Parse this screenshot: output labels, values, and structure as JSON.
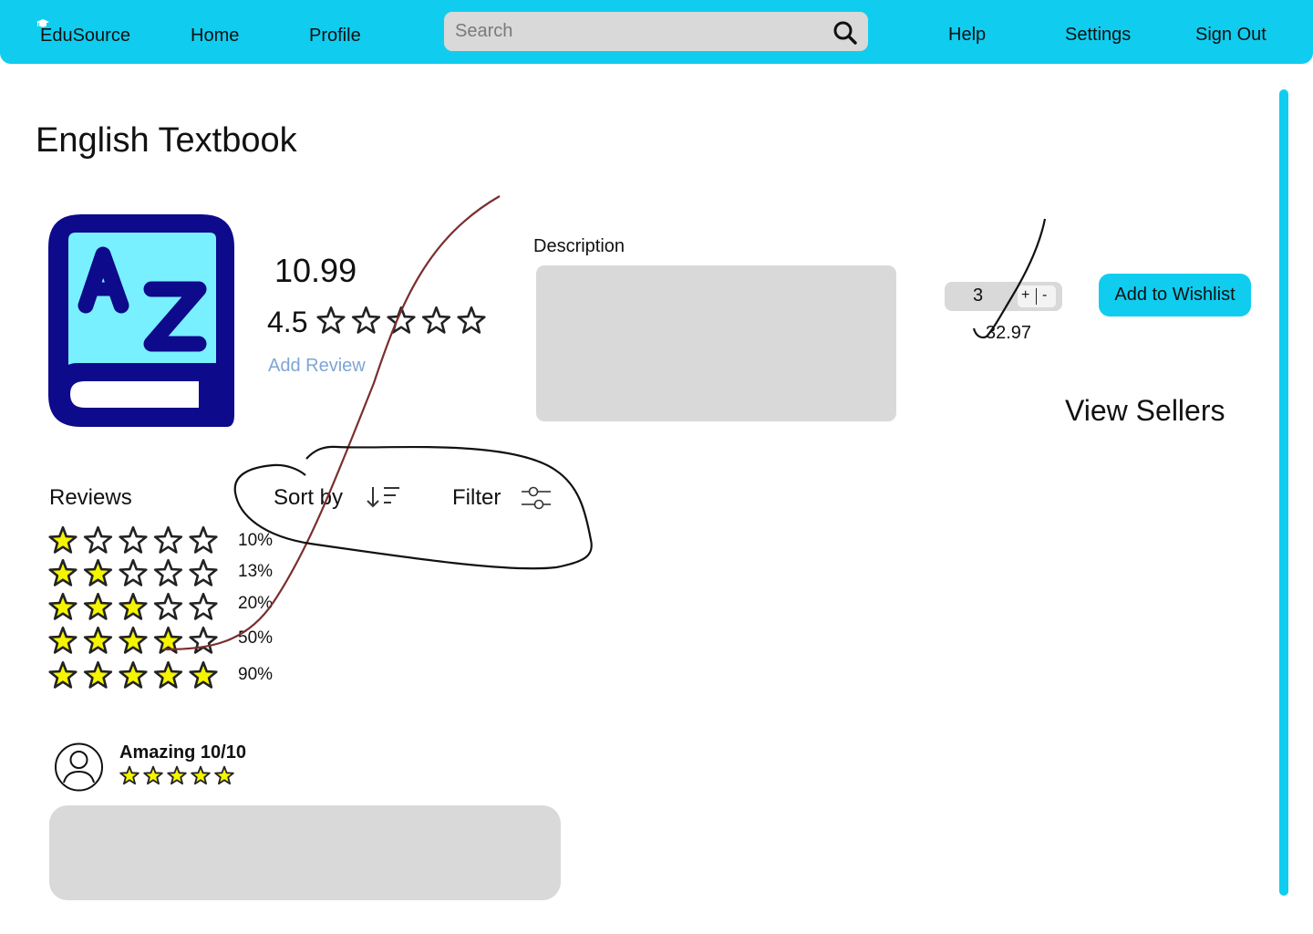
{
  "nav": {
    "logo": "EduSource",
    "home": "Home",
    "profile": "Profile",
    "search_placeholder": "Search",
    "help": "Help",
    "settings": "Settings",
    "sign_out": "Sign Out"
  },
  "product": {
    "title": "English Textbook",
    "price": "10.99",
    "rating": "4.5",
    "rating_stars_filled": 0,
    "add_review": "Add Review",
    "description_label": "Description",
    "quantity": "3",
    "plus": "+",
    "minus": "-",
    "subtotal": "32.97",
    "wishlist_label": "Add to Wishlist",
    "view_sellers": "View Sellers"
  },
  "reviews": {
    "label": "Reviews",
    "sort_label": "Sort by",
    "filter_label": "Filter",
    "distribution": [
      {
        "stars": 1,
        "percent": "10%"
      },
      {
        "stars": 2,
        "percent": "13%"
      },
      {
        "stars": 3,
        "percent": "20%"
      },
      {
        "stars": 4,
        "percent": "50%"
      },
      {
        "stars": 5,
        "percent": "90%"
      }
    ],
    "items": [
      {
        "title": "Amazing 10/10",
        "stars": 5
      }
    ]
  },
  "colors": {
    "accent": "#10cdef",
    "star_fill": "#f5f500",
    "link": "#7ea6d4",
    "placeholder_box": "#d9d9d9",
    "book_icon_dark": "#0d0a8c",
    "book_icon_light": "#79f0ff",
    "annotation_red": "#7a2e2e"
  },
  "icons": {
    "logo": "graduation-cap-icon",
    "search": "search-icon",
    "product": "book-az-icon",
    "sort": "sort-descending-icon",
    "filter": "sliders-icon",
    "avatar": "user-avatar-icon"
  }
}
